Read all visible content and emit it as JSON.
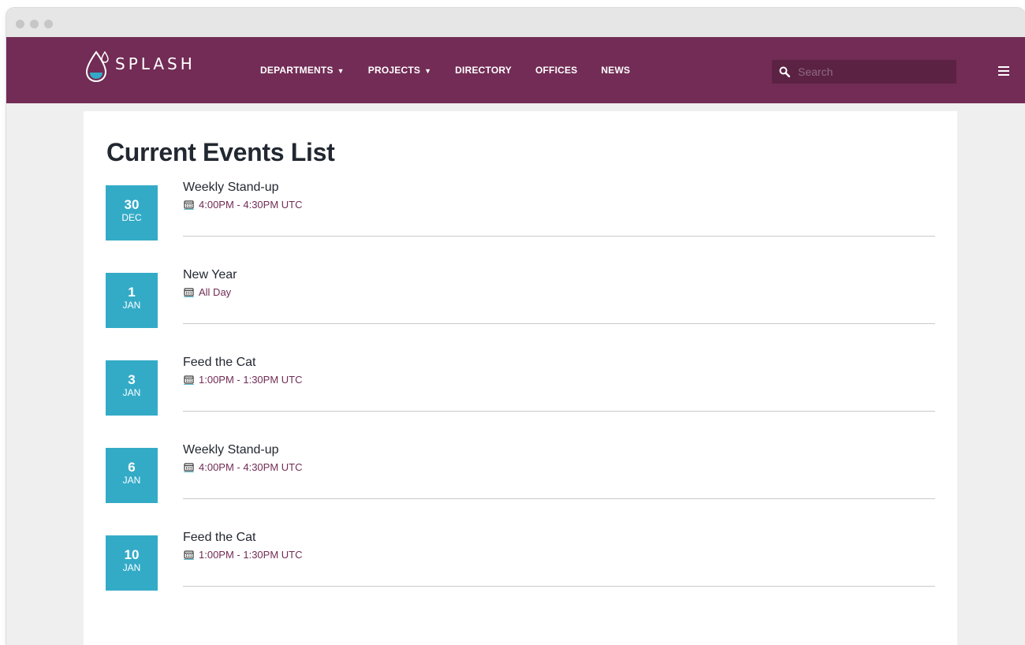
{
  "logo": {
    "text": "SPLASH"
  },
  "nav": {
    "items": [
      {
        "label": "DEPARTMENTS",
        "has_dropdown": true
      },
      {
        "label": "PROJECTS",
        "has_dropdown": true
      },
      {
        "label": "DIRECTORY",
        "has_dropdown": false
      },
      {
        "label": "OFFICES",
        "has_dropdown": false
      },
      {
        "label": "NEWS",
        "has_dropdown": false
      }
    ],
    "search": {
      "placeholder": "Search",
      "value": ""
    },
    "menu_icon": "hamburger-menu-icon"
  },
  "page": {
    "title": "Current Events List"
  },
  "events": [
    {
      "day": "30",
      "month": "DEC",
      "title": "Weekly Stand-up",
      "time": "4:00PM - 4:30PM UTC"
    },
    {
      "day": "1",
      "month": "JAN",
      "title": "New Year",
      "time": "All Day"
    },
    {
      "day": "3",
      "month": "JAN",
      "title": "Feed the Cat",
      "time": "1:00PM - 1:30PM UTC"
    },
    {
      "day": "6",
      "month": "JAN",
      "title": "Weekly Stand-up",
      "time": "4:00PM - 4:30PM UTC"
    },
    {
      "day": "10",
      "month": "JAN",
      "title": "Feed the Cat",
      "time": "1:00PM - 1:30PM UTC"
    }
  ],
  "colors": {
    "navbar": "#722c55",
    "search_bg": "#5b2244",
    "date_box": "#33abc7",
    "time_text": "#722c55",
    "page_bg": "#efeff0",
    "content_bg": "#ffffff"
  }
}
